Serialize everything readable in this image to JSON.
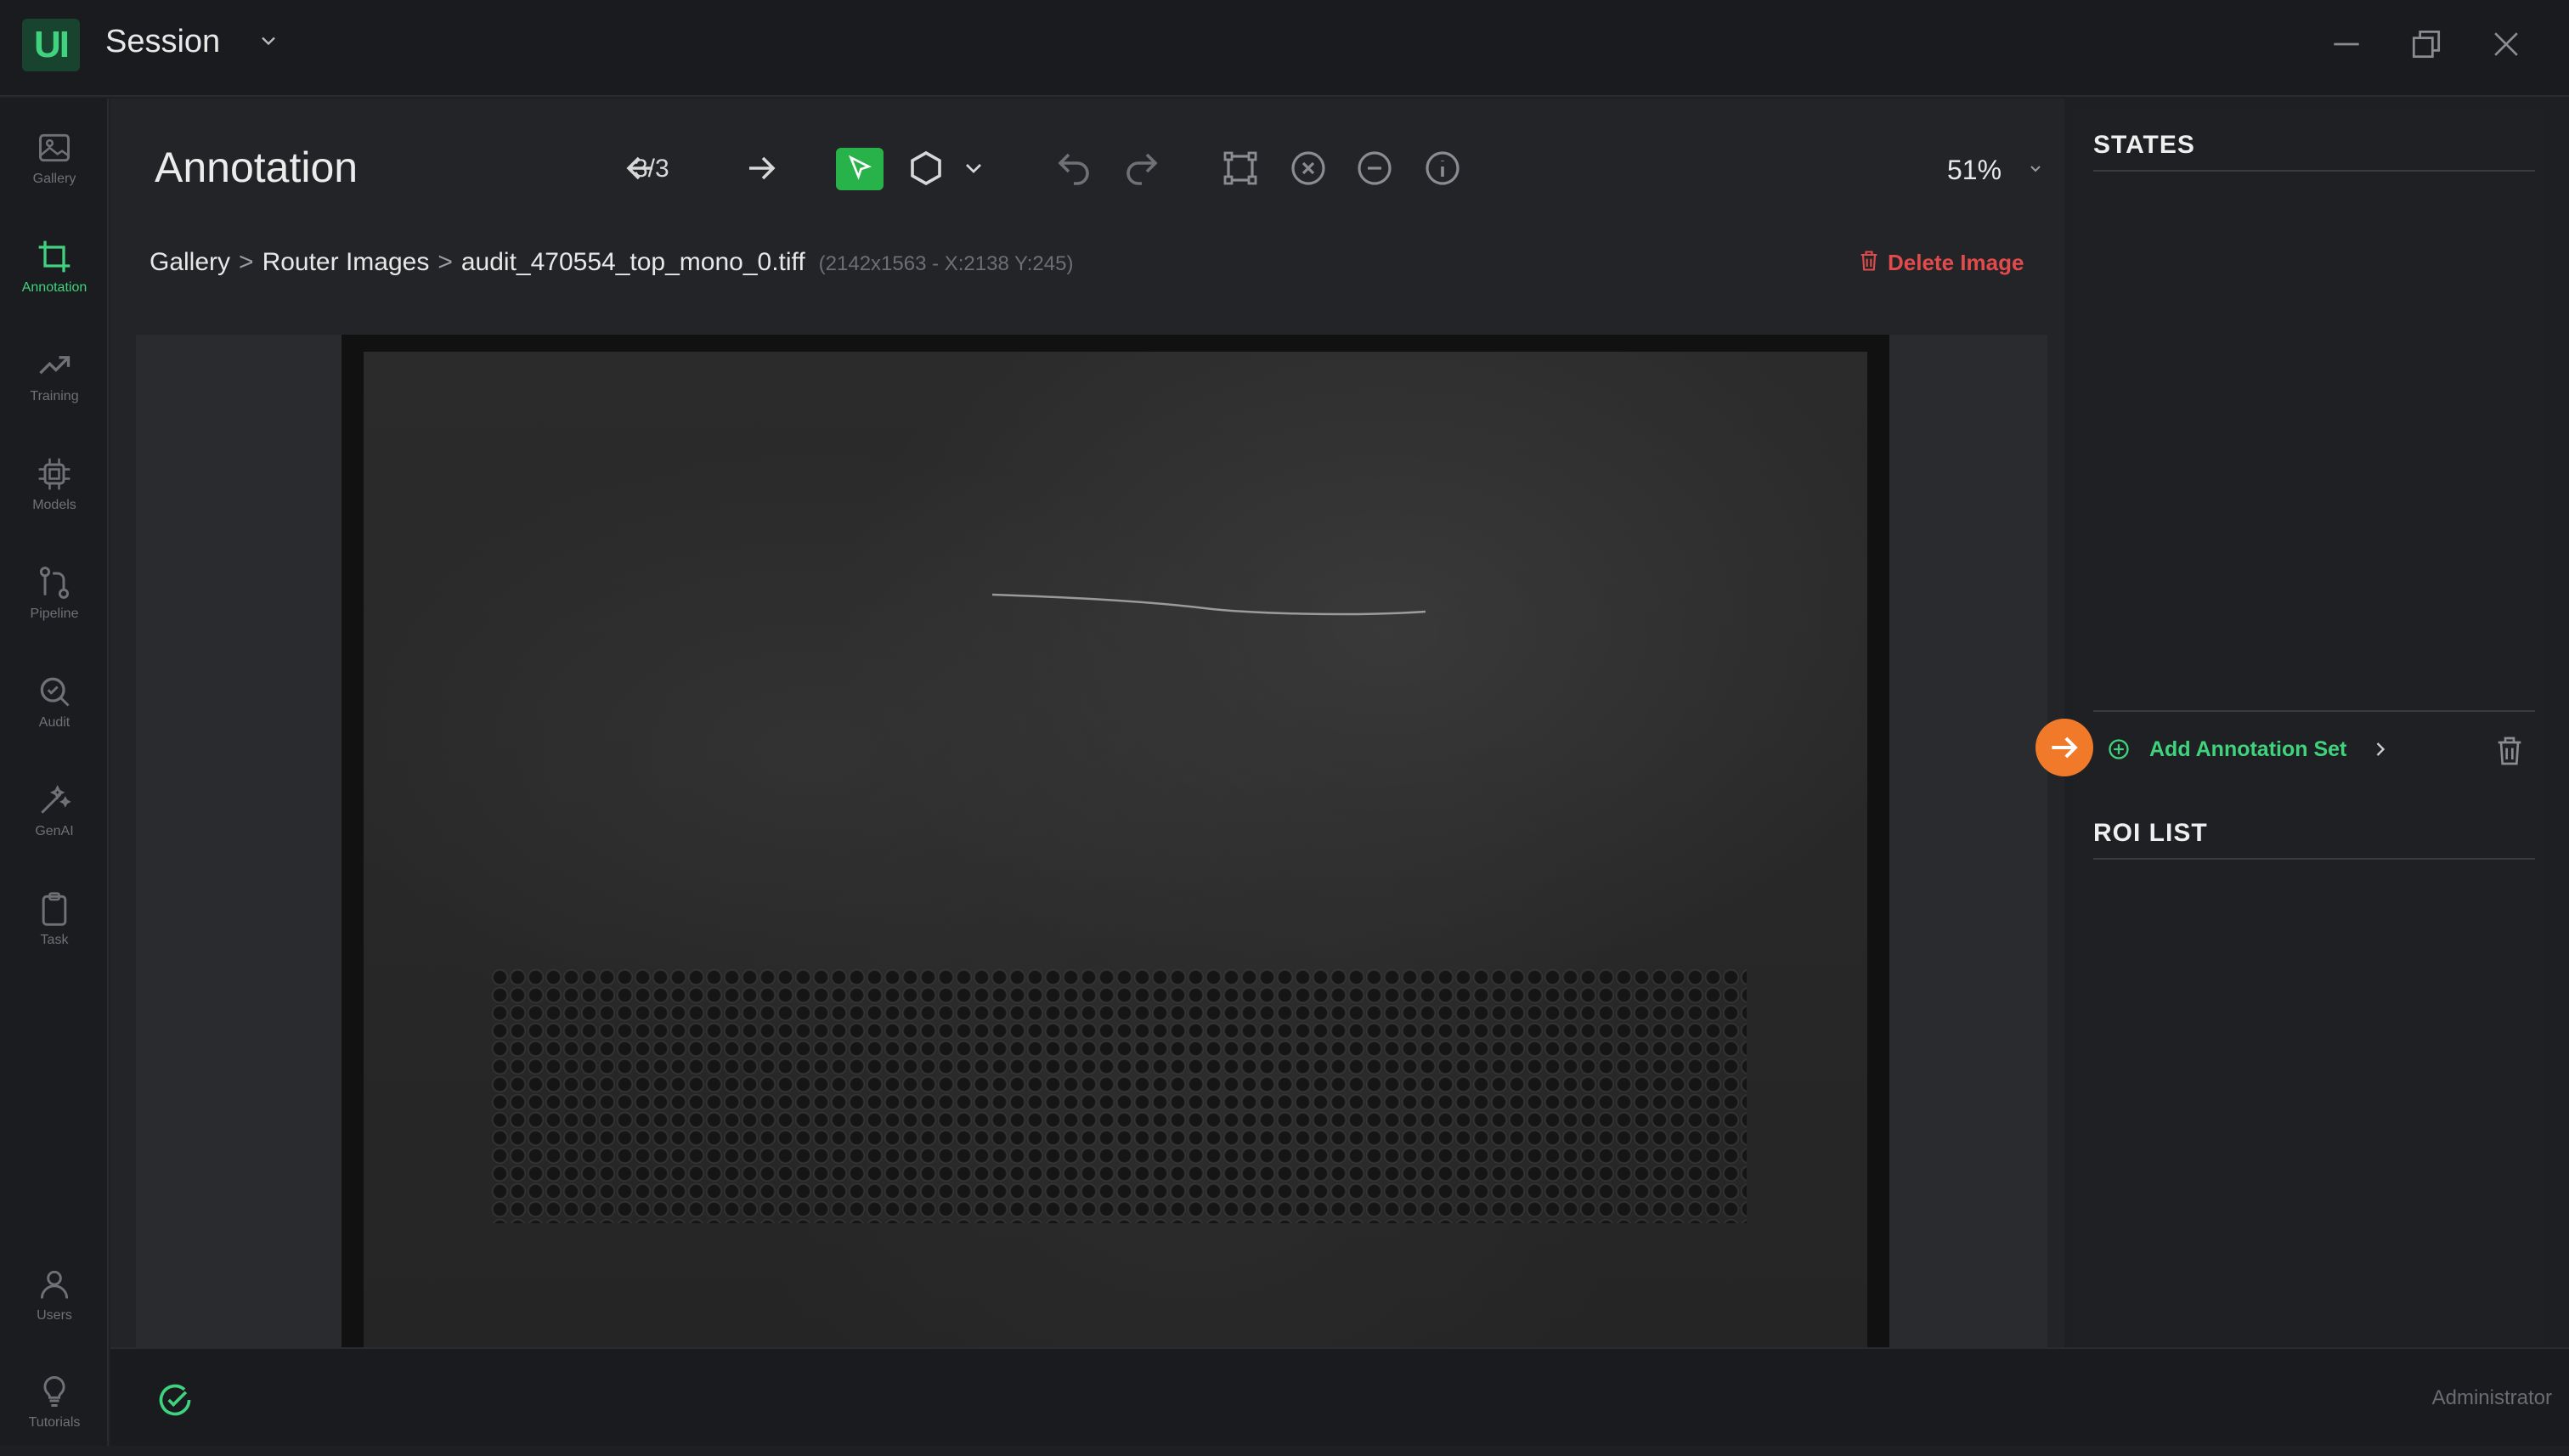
{
  "app": {
    "logo_text": "UI",
    "session_title": "Session"
  },
  "sidebar": {
    "items": [
      {
        "label": "Gallery",
        "icon": "image-icon",
        "active": false
      },
      {
        "label": "Annotation",
        "icon": "crop-icon",
        "active": true
      },
      {
        "label": "Training",
        "icon": "trend-icon",
        "active": false
      },
      {
        "label": "Models",
        "icon": "chip-icon",
        "active": false
      },
      {
        "label": "Pipeline",
        "icon": "pipeline-icon",
        "active": false
      },
      {
        "label": "Audit",
        "icon": "search-icon",
        "active": false
      },
      {
        "label": "GenAI",
        "icon": "magic-wand-icon",
        "active": false
      },
      {
        "label": "Task",
        "icon": "clipboard-icon",
        "active": false
      }
    ],
    "bottom_items": [
      {
        "label": "Users",
        "icon": "user-icon"
      },
      {
        "label": "Tutorials",
        "icon": "lightbulb-icon"
      }
    ]
  },
  "header": {
    "title": "Annotation",
    "pager": "3/3",
    "zoom": "51%"
  },
  "breadcrumb": {
    "items": [
      "Gallery",
      "Router Images",
      "audit_470554_top_mono_0.tiff"
    ],
    "separator": ">",
    "meta": "(2142x1563 - X:2138 Y:245)"
  },
  "actions": {
    "delete_image": "Delete Image"
  },
  "right_panel": {
    "states_title": "STATES",
    "add_annotation_set": "Add Annotation Set",
    "roi_title": "ROI LIST"
  },
  "footer": {
    "user": "Administrator"
  },
  "colors": {
    "accent": "#3fd37e",
    "danger": "#e14b4b",
    "orange": "#f07a2a",
    "select_tool": "#27b24a"
  }
}
